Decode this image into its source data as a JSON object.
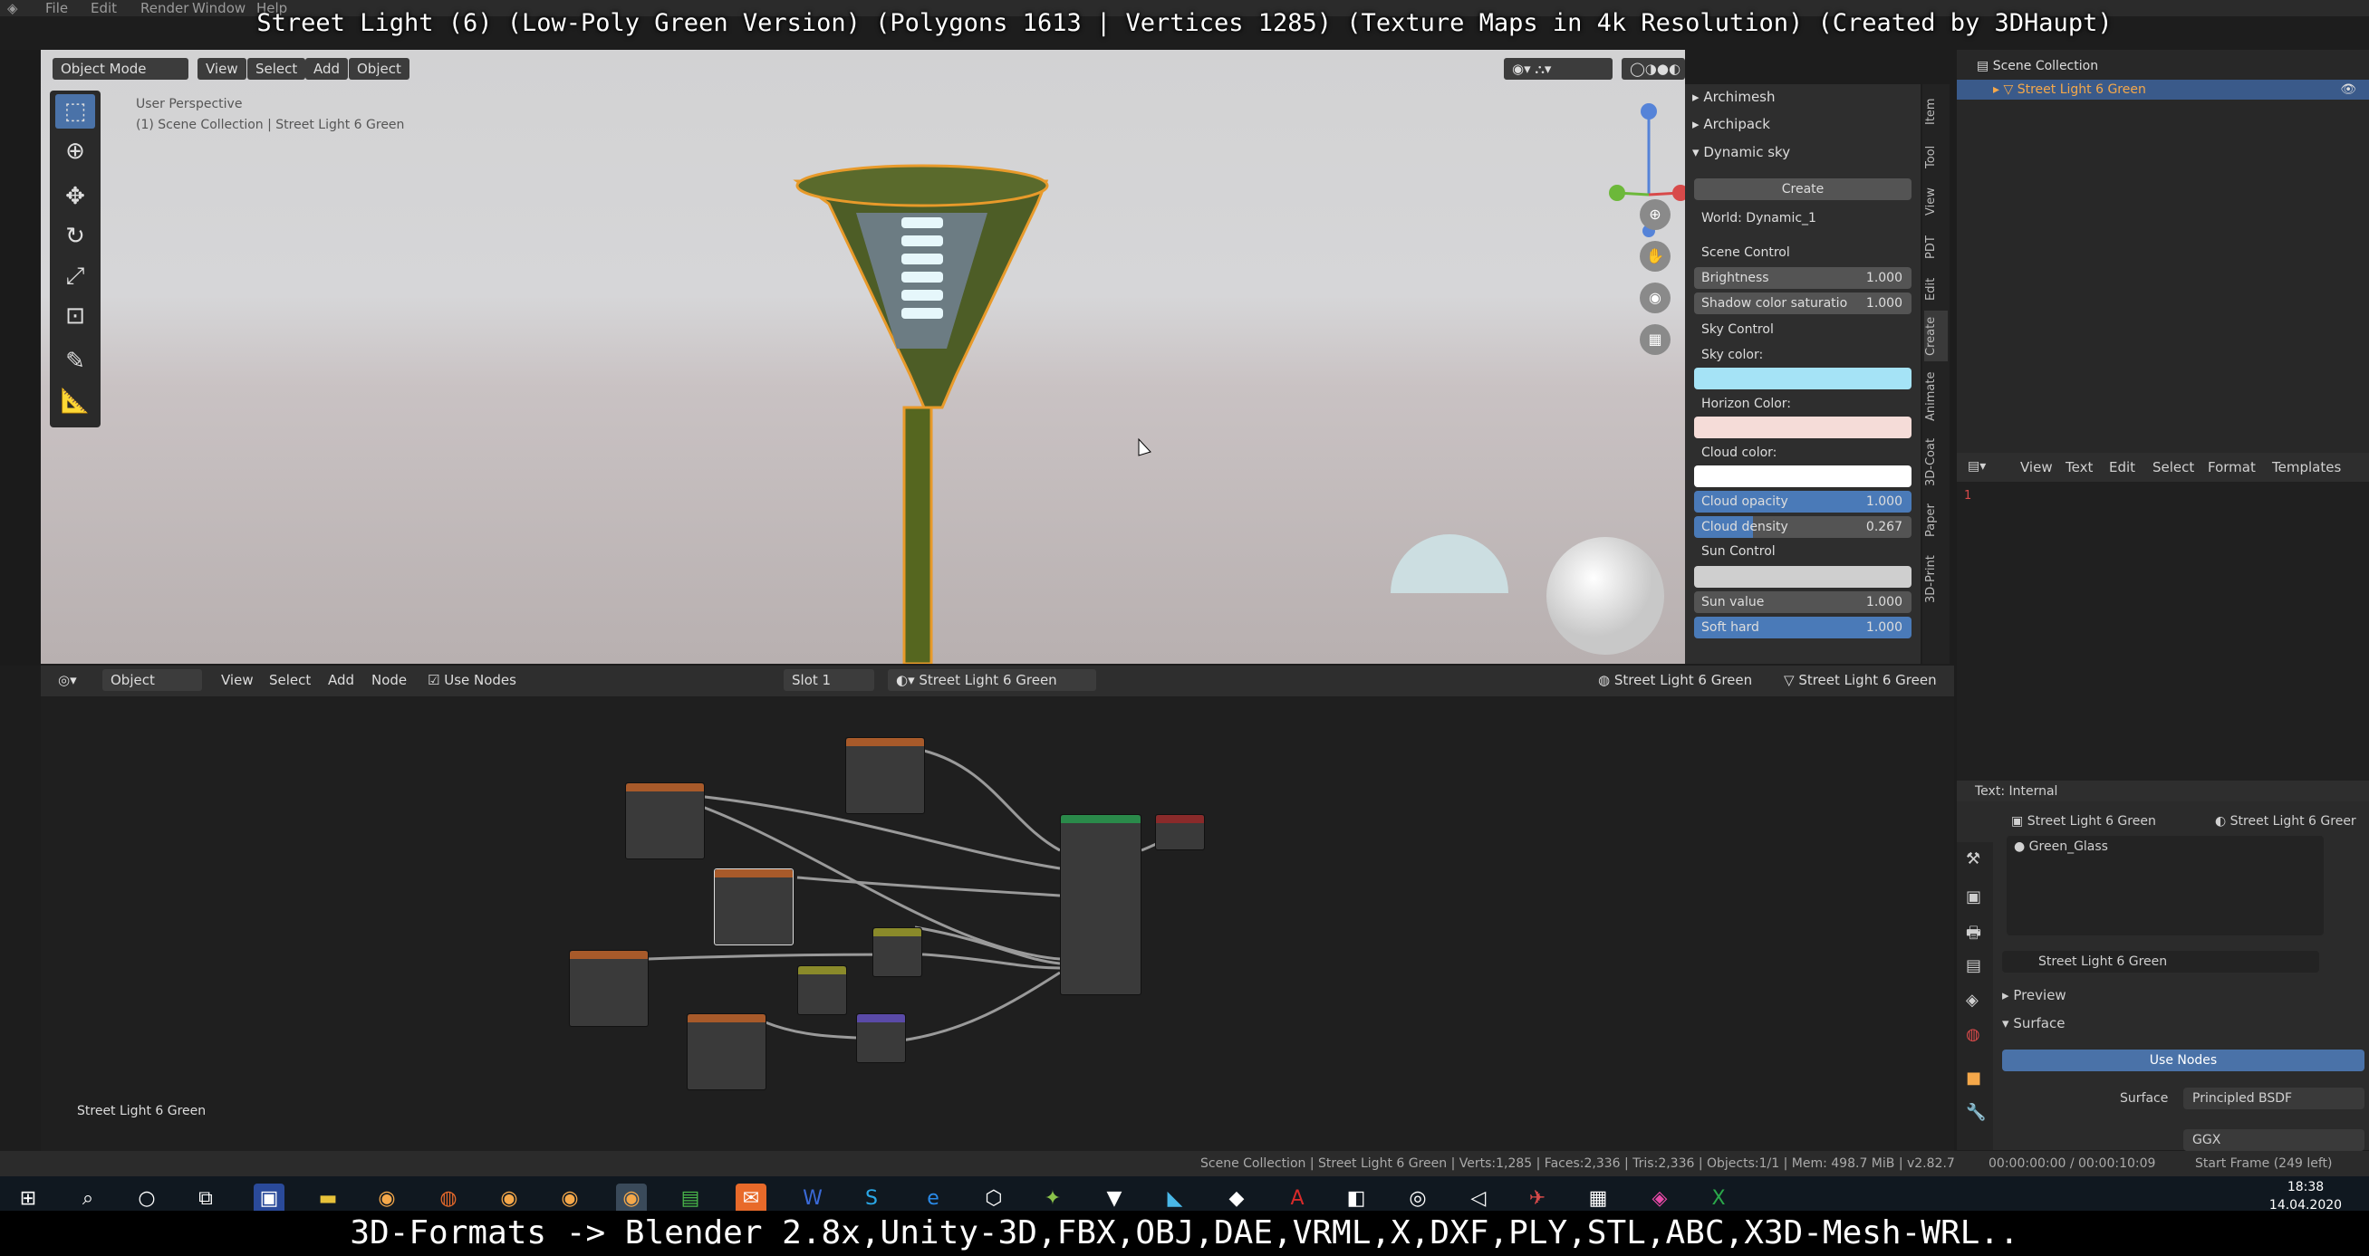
{
  "top_menu": [
    "File",
    "Edit",
    "Render",
    "Window",
    "Help"
  ],
  "video_title": "Street Light (6) (Low-Poly Green Version) (Polygons 1613 | Vertices 1285) (Texture Maps in 4k Resolution) (Created by 3DHaupt)",
  "bottom_caption": "3D-Formats -> Blender 2.8x,Unity-3D,FBX,OBJ,DAE,VRML,X,DXF,PLY,STL,ABC,X3D-Mesh-WRL..",
  "viewport": {
    "mode": "Object Mode",
    "menus": [
      "View",
      "Select",
      "Add",
      "Object"
    ],
    "perspective": "User Perspective",
    "collection_info": "(1) Scene Collection | Street Light 6 Green"
  },
  "npanel": {
    "sections": [
      "Archimesh",
      "Archipack",
      "Dynamic sky"
    ],
    "create_label": "Create",
    "world": "World: Dynamic_1",
    "scene_control": "Scene Control",
    "brightness": {
      "label": "Brightness",
      "value": "1.000"
    },
    "shadow": {
      "label": "Shadow color saturatio",
      "value": "1.000"
    },
    "sky_control": "Sky Control",
    "sky_color_label": "Sky color:",
    "horizon_color_label": "Horizon Color:",
    "cloud_color_label": "Cloud color:",
    "cloud_opacity": {
      "label": "Cloud opacity",
      "value": "1.000"
    },
    "cloud_density": {
      "label": "Cloud density",
      "value": "0.267"
    },
    "sun_control": "Sun Control",
    "sun_value": {
      "label": "Sun value",
      "value": "1.000"
    },
    "soft_hard": {
      "label": "Soft hard",
      "value": "1.000"
    },
    "colors": {
      "sky": "#a5e3f6",
      "horizon": "#f5dcd8",
      "cloud": "#ffffff",
      "sun": "#cfcfcf",
      "slider": "#4a7ab8"
    }
  },
  "vtabs": [
    "Item",
    "Tool",
    "View",
    "PDT",
    "Edit",
    "Create",
    "Animate",
    "3D-Coat",
    "Paper",
    "3D-Print"
  ],
  "outliner": {
    "root": "Scene Collection",
    "item": "Street Light 6 Green"
  },
  "text_editor": {
    "menus": [
      "View",
      "Text",
      "Edit",
      "Select",
      "Format",
      "Templates"
    ],
    "line_number": "1",
    "footer": "Text: Internal"
  },
  "properties": {
    "object": "Street Light 6 Green",
    "material_header": "Street Light 6 Greer",
    "slot": "Green_Glass",
    "material": "Street Light 6 Green",
    "preview": "Preview",
    "surface": "Surface",
    "use_nodes": "Use Nodes",
    "surface_label": "Surface",
    "surface_value": "Principled BSDF",
    "distribution": "GGX"
  },
  "node_header": {
    "editor_type": "Object",
    "menus": [
      "View",
      "Select",
      "Add",
      "Node"
    ],
    "use_nodes": "Use Nodes",
    "slot": "Slot 1",
    "material": "Street Light 6 Green",
    "right_object": "Street Light 6 Green",
    "right_mesh": "Street Light 6 Green"
  },
  "node_editor_label": "Street Light 6 Green",
  "statusbar": {
    "stats": "Scene Collection | Street Light 6 Green | Verts:1,285 | Faces:2,336 | Tris:2,336 | Objects:1/1 | Mem: 498.7 MiB | v2.82.7",
    "time": "00:00:00:00 / 00:00:10:09",
    "frame": "Start Frame (249 left)"
  },
  "taskbar": {
    "clock": "18:38",
    "date": "14.04.2020"
  }
}
